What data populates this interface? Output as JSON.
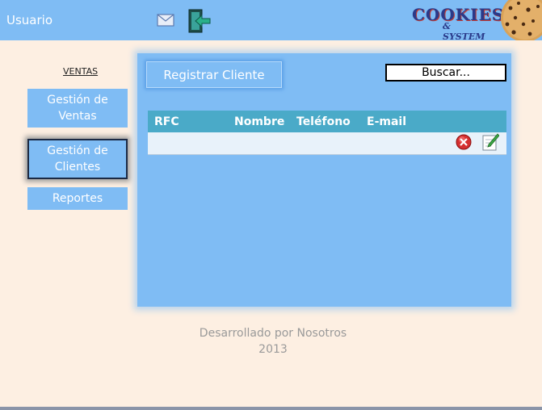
{
  "header": {
    "user_label": "Usuario",
    "icons": [
      "mail-icon",
      "exit-icon"
    ],
    "logo": {
      "line1": "COOKIES",
      "line2": "& SYSTEM"
    }
  },
  "sidebar": {
    "title": "VENTAS",
    "items": [
      {
        "label_line1": "Gestión de",
        "label_line2": "Ventas",
        "active": false
      },
      {
        "label_line1": "Gestión de",
        "label_line2": "Clientes",
        "active": true
      },
      {
        "label_line1": "Reportes",
        "label_line2": "",
        "active": false
      }
    ]
  },
  "main": {
    "register_button": "Registrar Cliente",
    "search_value": "Buscar...",
    "table": {
      "columns": [
        "RFC",
        "Nombre",
        "Teléfono",
        "E-mail"
      ],
      "rows": [
        [
          "",
          "",
          "",
          ""
        ]
      ],
      "row_actions": [
        "delete-icon",
        "edit-icon"
      ]
    }
  },
  "footer": {
    "line1": "Desarrollado por Nosotros",
    "line2": "2013"
  },
  "colors": {
    "accent": "#7fbcf4",
    "table_header": "#4aaac8",
    "background": "#fdefe2"
  }
}
